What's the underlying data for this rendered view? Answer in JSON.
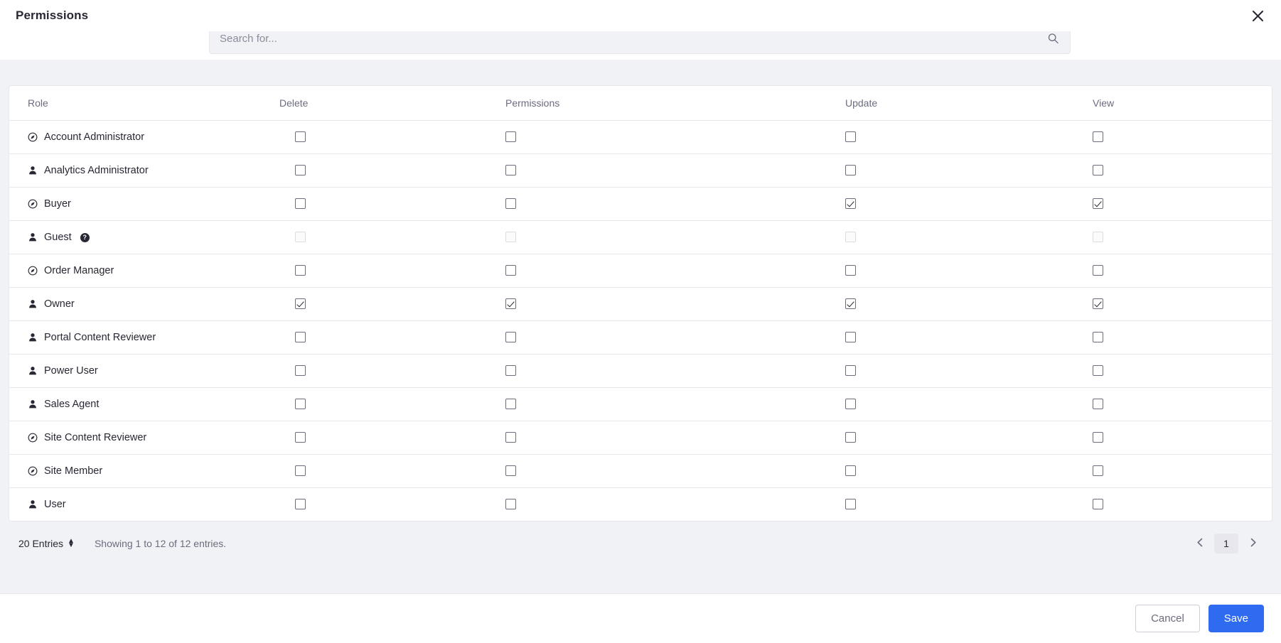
{
  "header": {
    "title": "Permissions",
    "close_icon": "close-icon"
  },
  "search": {
    "placeholder": "Search for...",
    "value": "",
    "icon": "search-icon"
  },
  "table": {
    "columns": [
      "Role",
      "Delete",
      "Permissions",
      "Update",
      "View"
    ],
    "rows": [
      {
        "role": "Account Administrator",
        "icon": "compass-icon",
        "disabled": false,
        "delete": false,
        "permissions": false,
        "update": false,
        "view": false,
        "help": false
      },
      {
        "role": "Analytics Administrator",
        "icon": "user-icon",
        "disabled": false,
        "delete": false,
        "permissions": false,
        "update": false,
        "view": false,
        "help": false
      },
      {
        "role": "Buyer",
        "icon": "compass-icon",
        "disabled": false,
        "delete": false,
        "permissions": false,
        "update": true,
        "view": true,
        "help": false
      },
      {
        "role": "Guest",
        "icon": "user-icon",
        "disabled": true,
        "delete": false,
        "permissions": false,
        "update": false,
        "view": false,
        "help": true,
        "help_label": "?"
      },
      {
        "role": "Order Manager",
        "icon": "compass-icon",
        "disabled": false,
        "delete": false,
        "permissions": false,
        "update": false,
        "view": false,
        "help": false
      },
      {
        "role": "Owner",
        "icon": "user-icon",
        "disabled": false,
        "delete": true,
        "permissions": true,
        "update": true,
        "view": true,
        "help": false
      },
      {
        "role": "Portal Content Reviewer",
        "icon": "user-icon",
        "disabled": false,
        "delete": false,
        "permissions": false,
        "update": false,
        "view": false,
        "help": false
      },
      {
        "role": "Power User",
        "icon": "user-icon",
        "disabled": false,
        "delete": false,
        "permissions": false,
        "update": false,
        "view": false,
        "help": false
      },
      {
        "role": "Sales Agent",
        "icon": "user-icon",
        "disabled": false,
        "delete": false,
        "permissions": false,
        "update": false,
        "view": false,
        "help": false
      },
      {
        "role": "Site Content Reviewer",
        "icon": "compass-icon",
        "disabled": false,
        "delete": false,
        "permissions": false,
        "update": false,
        "view": false,
        "help": false
      },
      {
        "role": "Site Member",
        "icon": "compass-icon",
        "disabled": false,
        "delete": false,
        "permissions": false,
        "update": false,
        "view": false,
        "help": false
      },
      {
        "role": "User",
        "icon": "user-icon",
        "disabled": false,
        "delete": false,
        "permissions": false,
        "update": false,
        "view": false,
        "help": false
      }
    ]
  },
  "pagination": {
    "entries_label": "20 Entries",
    "showing_text": "Showing 1 to 12 of 12 entries.",
    "current_page": "1",
    "prev_icon": "chevron-left-icon",
    "next_icon": "chevron-right-icon"
  },
  "footer": {
    "cancel_label": "Cancel",
    "save_label": "Save"
  },
  "colors": {
    "accent": "#2e6bf0",
    "background": "#f1f2f5",
    "surface": "#ffffff",
    "border": "#e7e7ed",
    "text": "#272833",
    "muted": "#6b6c7e"
  }
}
